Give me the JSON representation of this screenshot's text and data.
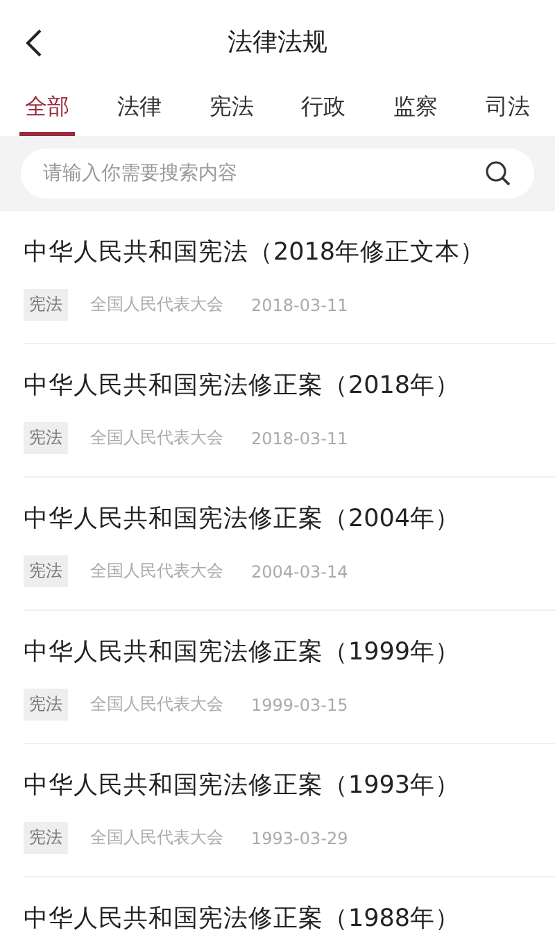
{
  "header": {
    "title": "法律法规"
  },
  "tabs": [
    {
      "label": "全部",
      "selected": true
    },
    {
      "label": "法律",
      "selected": false
    },
    {
      "label": "宪法",
      "selected": false
    },
    {
      "label": "行政",
      "selected": false
    },
    {
      "label": "监察",
      "selected": false
    },
    {
      "label": "司法",
      "selected": false
    }
  ],
  "search": {
    "placeholder": "请输入你需要搜索内容"
  },
  "items": [
    {
      "title": "中华人民共和国宪法（2018年修正文本）",
      "tag": "宪法",
      "issuer": "全国人民代表大会",
      "date": "2018-03-11"
    },
    {
      "title": "中华人民共和国宪法修正案（2018年）",
      "tag": "宪法",
      "issuer": "全国人民代表大会",
      "date": "2018-03-11"
    },
    {
      "title": "中华人民共和国宪法修正案（2004年）",
      "tag": "宪法",
      "issuer": "全国人民代表大会",
      "date": "2004-03-14"
    },
    {
      "title": "中华人民共和国宪法修正案（1999年）",
      "tag": "宪法",
      "issuer": "全国人民代表大会",
      "date": "1999-03-15"
    },
    {
      "title": "中华人民共和国宪法修正案（1993年）",
      "tag": "宪法",
      "issuer": "全国人民代表大会",
      "date": "1993-03-29"
    },
    {
      "title": "中华人民共和国宪法修正案（1988年）"
    }
  ]
}
